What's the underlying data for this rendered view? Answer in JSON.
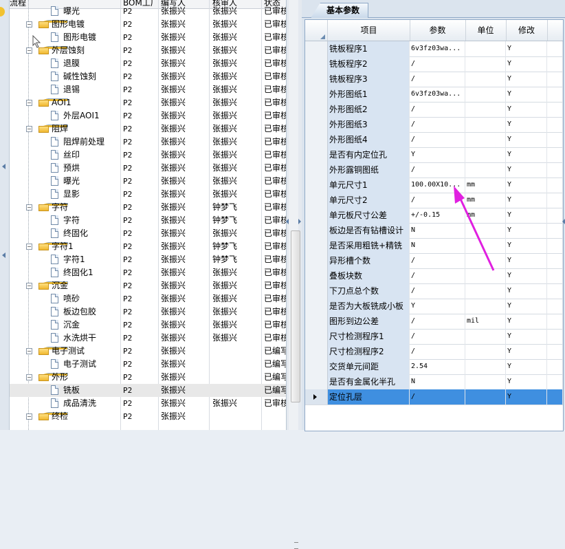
{
  "tree": {
    "columns": [
      "流程",
      "BOM工厂",
      "编写人",
      "核审人",
      "状态"
    ],
    "rows": [
      {
        "level": 2,
        "type": "item",
        "name": "曝光",
        "bom": "P2",
        "writer": "张振兴",
        "reviewer": "张振兴",
        "status": "已审核"
      },
      {
        "level": 1,
        "type": "group",
        "name": "图形电镀",
        "bom": "P2",
        "writer": "张振兴",
        "reviewer": "张振兴",
        "status": "已审核"
      },
      {
        "level": 2,
        "type": "item",
        "name": "图形电镀",
        "bom": "P2",
        "writer": "张振兴",
        "reviewer": "张振兴",
        "status": "已审核"
      },
      {
        "level": 1,
        "type": "group",
        "name": "外层蚀刻",
        "bom": "P2",
        "writer": "张振兴",
        "reviewer": "张振兴",
        "status": "已审核"
      },
      {
        "level": 2,
        "type": "item",
        "name": "退膜",
        "bom": "P2",
        "writer": "张振兴",
        "reviewer": "张振兴",
        "status": "已审核"
      },
      {
        "level": 2,
        "type": "item",
        "name": "碱性蚀刻",
        "bom": "P2",
        "writer": "张振兴",
        "reviewer": "张振兴",
        "status": "已审核"
      },
      {
        "level": 2,
        "type": "item",
        "name": "退锡",
        "bom": "P2",
        "writer": "张振兴",
        "reviewer": "张振兴",
        "status": "已审核"
      },
      {
        "level": 1,
        "type": "group",
        "name": "AOI1",
        "bom": "P2",
        "writer": "张振兴",
        "reviewer": "张振兴",
        "status": "已审核"
      },
      {
        "level": 2,
        "type": "item",
        "name": "外层AOI1",
        "bom": "P2",
        "writer": "张振兴",
        "reviewer": "张振兴",
        "status": "已审核"
      },
      {
        "level": 1,
        "type": "group",
        "name": "阻焊",
        "bom": "P2",
        "writer": "张振兴",
        "reviewer": "张振兴",
        "status": "已审核"
      },
      {
        "level": 2,
        "type": "item",
        "name": "阻焊前处理",
        "bom": "P2",
        "writer": "张振兴",
        "reviewer": "张振兴",
        "status": "已审核"
      },
      {
        "level": 2,
        "type": "item",
        "name": "丝印",
        "bom": "P2",
        "writer": "张振兴",
        "reviewer": "张振兴",
        "status": "已审核"
      },
      {
        "level": 2,
        "type": "item",
        "name": "预烘",
        "bom": "P2",
        "writer": "张振兴",
        "reviewer": "张振兴",
        "status": "已审核"
      },
      {
        "level": 2,
        "type": "item",
        "name": "曝光",
        "bom": "P2",
        "writer": "张振兴",
        "reviewer": "张振兴",
        "status": "已审核"
      },
      {
        "level": 2,
        "type": "item",
        "name": "显影",
        "bom": "P2",
        "writer": "张振兴",
        "reviewer": "张振兴",
        "status": "已审核"
      },
      {
        "level": 1,
        "type": "group",
        "name": "字符",
        "bom": "P2",
        "writer": "张振兴",
        "reviewer": "钟梦飞",
        "status": "已审核"
      },
      {
        "level": 2,
        "type": "item",
        "name": "字符",
        "bom": "P2",
        "writer": "张振兴",
        "reviewer": "钟梦飞",
        "status": "已审核"
      },
      {
        "level": 2,
        "type": "item",
        "name": "终固化",
        "bom": "P2",
        "writer": "张振兴",
        "reviewer": "张振兴",
        "status": "已审核"
      },
      {
        "level": 1,
        "type": "group",
        "name": "字符1",
        "bom": "P2",
        "writer": "张振兴",
        "reviewer": "钟梦飞",
        "status": "已审核"
      },
      {
        "level": 2,
        "type": "item",
        "name": "字符1",
        "bom": "P2",
        "writer": "张振兴",
        "reviewer": "钟梦飞",
        "status": "已审核"
      },
      {
        "level": 2,
        "type": "item",
        "name": "终固化1",
        "bom": "P2",
        "writer": "张振兴",
        "reviewer": "张振兴",
        "status": "已审核"
      },
      {
        "level": 1,
        "type": "group",
        "name": "沉金",
        "bom": "P2",
        "writer": "张振兴",
        "reviewer": "张振兴",
        "status": "已审核"
      },
      {
        "level": 2,
        "type": "item",
        "name": "喷砂",
        "bom": "P2",
        "writer": "张振兴",
        "reviewer": "张振兴",
        "status": "已审核"
      },
      {
        "level": 2,
        "type": "item",
        "name": "板边包胶",
        "bom": "P2",
        "writer": "张振兴",
        "reviewer": "张振兴",
        "status": "已审核"
      },
      {
        "level": 2,
        "type": "item",
        "name": "沉金",
        "bom": "P2",
        "writer": "张振兴",
        "reviewer": "张振兴",
        "status": "已审核"
      },
      {
        "level": 2,
        "type": "item",
        "name": "水洗烘干",
        "bom": "P2",
        "writer": "张振兴",
        "reviewer": "张振兴",
        "status": "已审核"
      },
      {
        "level": 1,
        "type": "group",
        "name": "电子测试",
        "bom": "P2",
        "writer": "张振兴",
        "reviewer": "",
        "status": "已编写"
      },
      {
        "level": 2,
        "type": "item",
        "name": "电子测试",
        "bom": "P2",
        "writer": "张振兴",
        "reviewer": "",
        "status": "已编写"
      },
      {
        "level": 1,
        "type": "group",
        "name": "外形",
        "bom": "P2",
        "writer": "张振兴",
        "reviewer": "",
        "status": "已编写"
      },
      {
        "level": 2,
        "type": "item",
        "name": "铣板",
        "bom": "P2",
        "writer": "张振兴",
        "reviewer": "",
        "status": "已编写",
        "selected": true
      },
      {
        "level": 2,
        "type": "item",
        "name": "成品清洗",
        "bom": "P2",
        "writer": "张振兴",
        "reviewer": "张振兴",
        "status": "已审核"
      },
      {
        "level": 1,
        "type": "group",
        "name": "终检",
        "bom": "P2",
        "writer": "张振兴",
        "reviewer": "",
        "status": ""
      }
    ]
  },
  "params": {
    "tab_label": "基本参数",
    "columns": [
      "项目",
      "参数",
      "单位",
      "修改"
    ],
    "rows": [
      {
        "item": "铣板程序1",
        "param": "6v3fz03wa...",
        "unit": "",
        "mod": "Y"
      },
      {
        "item": "铣板程序2",
        "param": "/",
        "unit": "",
        "mod": "Y"
      },
      {
        "item": "铣板程序3",
        "param": "/",
        "unit": "",
        "mod": "Y"
      },
      {
        "item": "外形图纸1",
        "param": "6v3fz03wa...",
        "unit": "",
        "mod": "Y"
      },
      {
        "item": "外形图纸2",
        "param": "/",
        "unit": "",
        "mod": "Y"
      },
      {
        "item": "外形图纸3",
        "param": "/",
        "unit": "",
        "mod": "Y"
      },
      {
        "item": "外形图纸4",
        "param": "/",
        "unit": "",
        "mod": "Y"
      },
      {
        "item": "是否有内定位孔",
        "param": "Y",
        "unit": "",
        "mod": "Y"
      },
      {
        "item": "外形露铜图纸",
        "param": "/",
        "unit": "",
        "mod": "Y"
      },
      {
        "item": "单元尺寸1",
        "param": "100.00X10...",
        "unit": "mm",
        "mod": "Y"
      },
      {
        "item": "单元尺寸2",
        "param": "/",
        "unit": "mm",
        "mod": "Y"
      },
      {
        "item": "单元板尺寸公差",
        "param": "+/-0.15",
        "unit": "mm",
        "mod": "Y"
      },
      {
        "item": "板边是否有钻槽设计",
        "param": "N",
        "unit": "",
        "mod": "Y"
      },
      {
        "item": "是否采用粗铣+精铣",
        "param": "N",
        "unit": "",
        "mod": "Y"
      },
      {
        "item": "异形槽个数",
        "param": "/",
        "unit": "",
        "mod": "Y"
      },
      {
        "item": "叠板块数",
        "param": "/",
        "unit": "",
        "mod": "Y"
      },
      {
        "item": "下刀点总个数",
        "param": "/",
        "unit": "",
        "mod": "Y"
      },
      {
        "item": "是否为大板铣成小板",
        "param": "Y",
        "unit": "",
        "mod": "Y"
      },
      {
        "item": "图形到边公差",
        "param": "/",
        "unit": "mil",
        "mod": "Y"
      },
      {
        "item": "尺寸检测程序1",
        "param": "/",
        "unit": "",
        "mod": "Y"
      },
      {
        "item": "尺寸检测程序2",
        "param": "/",
        "unit": "",
        "mod": "Y"
      },
      {
        "item": "交货单元间距",
        "param": "2.54",
        "unit": "",
        "mod": "Y"
      },
      {
        "item": "是否有金属化半孔",
        "param": "N",
        "unit": "",
        "mod": "Y"
      },
      {
        "item": "定位孔层",
        "param": "/",
        "unit": "",
        "mod": "Y",
        "current": true
      }
    ]
  },
  "colors": {
    "accent_arrow": "#e020e0",
    "selected_row": "#3f8fe0",
    "item_cell": "#d8e4f2"
  }
}
